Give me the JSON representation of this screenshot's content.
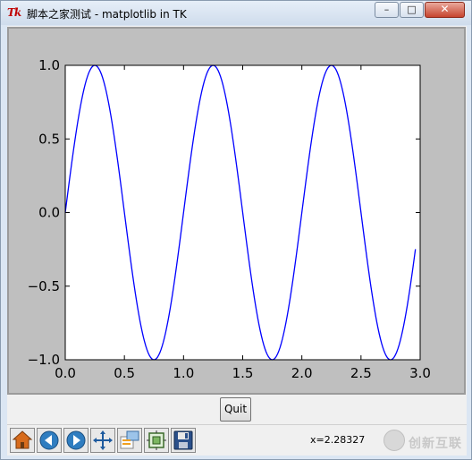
{
  "window": {
    "title": "脚本之家测试 - matplotlib in TK",
    "app_icon": "Tk",
    "controls": {
      "minimize": "–",
      "maximize": "□",
      "close": "✕"
    }
  },
  "buttons": {
    "quit_label": "Quit"
  },
  "toolbar": {
    "items": [
      "home-icon",
      "back-icon",
      "forward-icon",
      "pan-icon",
      "zoom-icon",
      "subplots-icon",
      "save-icon"
    ],
    "coordinate_readout": "x=2.28327"
  },
  "watermark": {
    "text": "创新互联"
  },
  "colors": {
    "line": "#0000ff",
    "figure_bg": "#bfbfbf",
    "axes_bg": "#ffffff"
  },
  "chart_data": {
    "type": "line",
    "title": "",
    "xlabel": "",
    "ylabel": "",
    "xlim": [
      0.0,
      3.0
    ],
    "ylim": [
      -1.0,
      1.0
    ],
    "x_ticks": [
      "0.0",
      "0.5",
      "1.0",
      "1.5",
      "2.0",
      "2.5",
      "3.0"
    ],
    "y_ticks": [
      "1.0",
      "0.5",
      "0.0",
      "−0.5",
      "−1.0"
    ],
    "x_tick_values": [
      0.0,
      0.5,
      1.0,
      1.5,
      2.0,
      2.5,
      3.0
    ],
    "y_tick_values": [
      1.0,
      0.5,
      0.0,
      -0.5,
      -1.0
    ],
    "grid": false,
    "series": [
      {
        "function": "sin(2πx)",
        "x_start": 0.0,
        "x_end": 2.96,
        "samples": 300,
        "color": "#0000ff"
      }
    ]
  }
}
